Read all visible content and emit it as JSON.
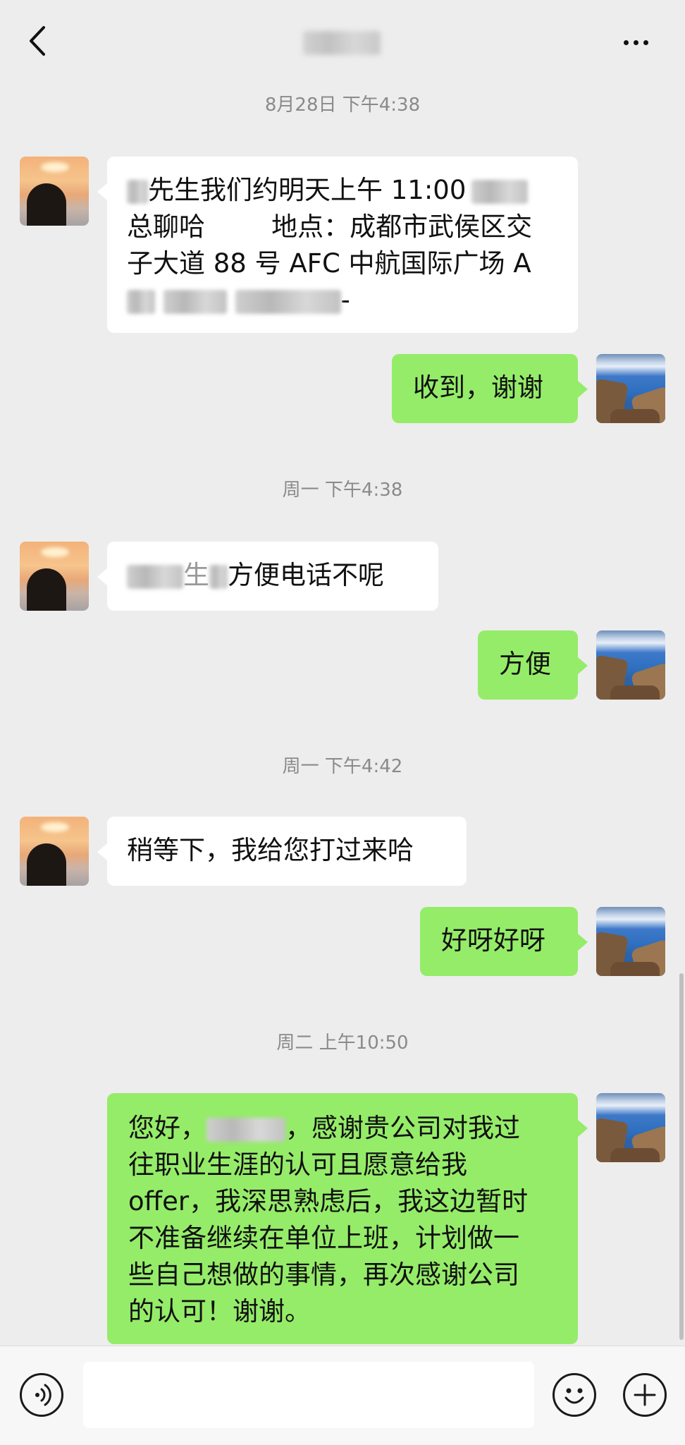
{
  "colors": {
    "background": "#ededed",
    "sent_bubble": "#95ec69",
    "received_bubble": "#ffffff",
    "timestamp_text": "#8a8a8a"
  },
  "header": {
    "back_icon": "chevron-left-icon",
    "more_icon": "ellipsis-icon"
  },
  "timestamps": [
    "8月28日 下午4:38",
    "周一 下午4:38",
    "周一 下午4:42",
    "周二 上午10:50"
  ],
  "messages": {
    "m1": {
      "line1": "先生我们约明天上午 11:00",
      "line2": "总聊哈        地点：成都市武侯区交",
      "line3": "子大道 88 号 AFC 中航国际广场 A",
      "line4_tail": "-"
    },
    "m2": {
      "text": "收到，谢谢"
    },
    "m3": {
      "mid": "生",
      "tail": "方便电话不呢"
    },
    "m4": {
      "text": "方便"
    },
    "m5": {
      "text": "稍等下，我给您打过来哈"
    },
    "m6": {
      "text": "好呀好呀"
    },
    "m7": {
      "line1a": "您好，",
      "line1b": "，感谢贵公司对我过",
      "line2": "往职业生涯的认可且愿意给我",
      "line3": "offer，我深思熟虑后，我这边暂时",
      "line4": "不准备继续在单位上班，计划做一",
      "line5": "些自己想做的事情，再次感谢公司",
      "line6": "的认可！谢谢。"
    }
  },
  "input_bar": {
    "voice_icon": "voice-icon",
    "emoji_icon": "emoji-icon",
    "plus_icon": "plus-icon"
  }
}
